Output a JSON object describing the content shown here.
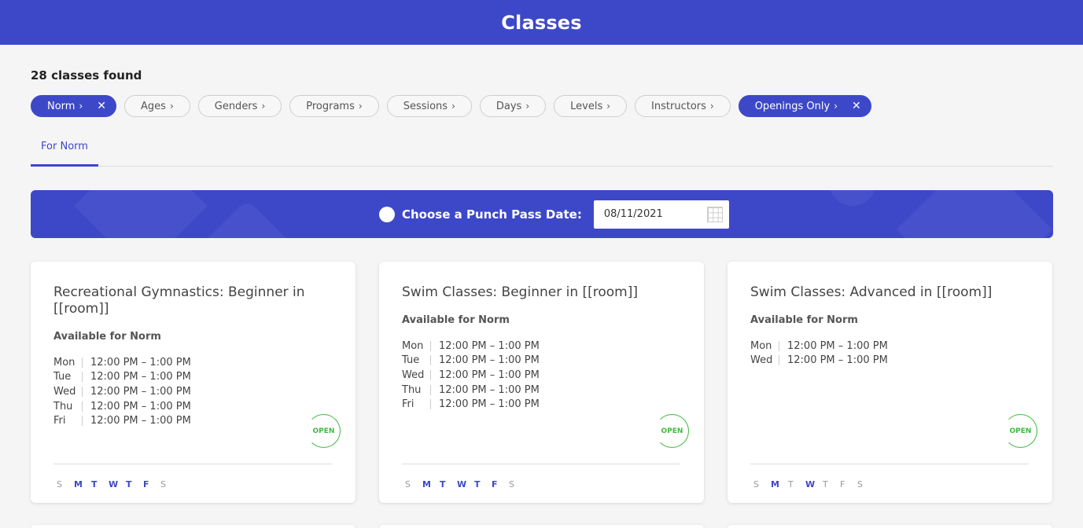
{
  "header": {
    "title": "Classes"
  },
  "results": {
    "count_label": "28 classes found"
  },
  "filters": [
    {
      "label": "Norm",
      "active": true
    },
    {
      "label": "Ages",
      "active": false
    },
    {
      "label": "Genders",
      "active": false
    },
    {
      "label": "Programs",
      "active": false
    },
    {
      "label": "Sessions",
      "active": false
    },
    {
      "label": "Days",
      "active": false
    },
    {
      "label": "Levels",
      "active": false
    },
    {
      "label": "Instructors",
      "active": false
    },
    {
      "label": "Openings Only",
      "active": true
    }
  ],
  "icons": {
    "chevron": "chevron-right-icon",
    "remove": "close-icon",
    "calendar": "calendar-icon",
    "badge": "flower-icon"
  },
  "glyphs": {
    "chevron": "›",
    "remove": "✕"
  },
  "tabs": [
    {
      "label": "For Norm",
      "active": true
    }
  ],
  "punch_pass": {
    "label": "Choose a Punch Pass Date:",
    "date_value": "08/11/2021"
  },
  "colors": {
    "accent": "#3d48c9",
    "open": "#3dbb3d"
  },
  "weekday_letters": [
    "S",
    "M",
    "T",
    "W",
    "T",
    "F",
    "S"
  ],
  "cards": [
    {
      "title": "Recreational Gymnastics: Beginner in [[room]]",
      "availability": "Available for Norm",
      "schedule": [
        {
          "day": "Mon",
          "time": "12:00 PM – 1:00 PM"
        },
        {
          "day": "Tue",
          "time": "12:00 PM – 1:00 PM"
        },
        {
          "day": "Wed",
          "time": "12:00 PM – 1:00 PM"
        },
        {
          "day": "Thu",
          "time": "12:00 PM – 1:00 PM"
        },
        {
          "day": "Fri",
          "time": "12:00 PM – 1:00 PM"
        }
      ],
      "status": "OPEN",
      "active_days": [
        false,
        true,
        true,
        true,
        true,
        true,
        false
      ]
    },
    {
      "title": "Swim Classes: Beginner in [[room]]",
      "availability": "Available for Norm",
      "schedule": [
        {
          "day": "Mon",
          "time": "12:00 PM – 1:00 PM"
        },
        {
          "day": "Tue",
          "time": "12:00 PM – 1:00 PM"
        },
        {
          "day": "Wed",
          "time": "12:00 PM – 1:00 PM"
        },
        {
          "day": "Thu",
          "time": "12:00 PM – 1:00 PM"
        },
        {
          "day": "Fri",
          "time": "12:00 PM – 1:00 PM"
        }
      ],
      "status": "OPEN",
      "active_days": [
        false,
        true,
        true,
        true,
        true,
        true,
        false
      ]
    },
    {
      "title": "Swim Classes: Advanced in [[room]]",
      "availability": "Available for Norm",
      "schedule": [
        {
          "day": "Mon",
          "time": "12:00 PM – 1:00 PM"
        },
        {
          "day": "Wed",
          "time": "12:00 PM – 1:00 PM"
        }
      ],
      "status": "OPEN",
      "active_days": [
        false,
        true,
        false,
        true,
        false,
        false,
        false
      ]
    }
  ]
}
